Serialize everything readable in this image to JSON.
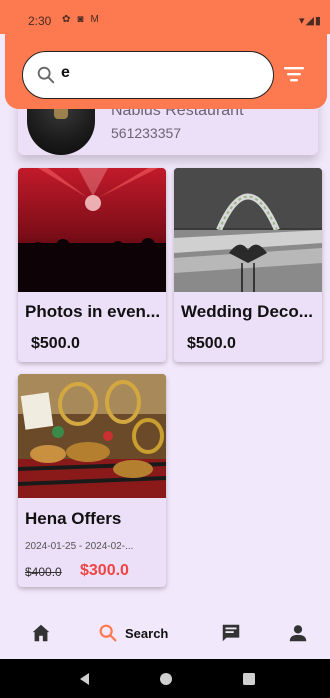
{
  "status_bar": {
    "time": "2:30",
    "left_icons": [
      "gear-icon",
      "notification-icon",
      "gmail-icon"
    ],
    "right_icons": "▾◢▮"
  },
  "search": {
    "value": "e"
  },
  "restaurant": {
    "name": "Nablus  Restaurant",
    "phone": "561233357"
  },
  "cards": [
    {
      "title": "Photos in even...",
      "price": "$500.0"
    },
    {
      "title": "Wedding Deco...",
      "price": "$500.0"
    },
    {
      "title": "Hena Offers",
      "date": "2024-01-25 - 2024-02-...",
      "old_price": "$400.0",
      "new_price": "$300.0"
    }
  ],
  "nav": {
    "search_label": "Search"
  },
  "colors": {
    "accent": "#fd7a50",
    "background": "#f1e8fb",
    "card": "#ecdff8",
    "sale": "#ef4444"
  }
}
